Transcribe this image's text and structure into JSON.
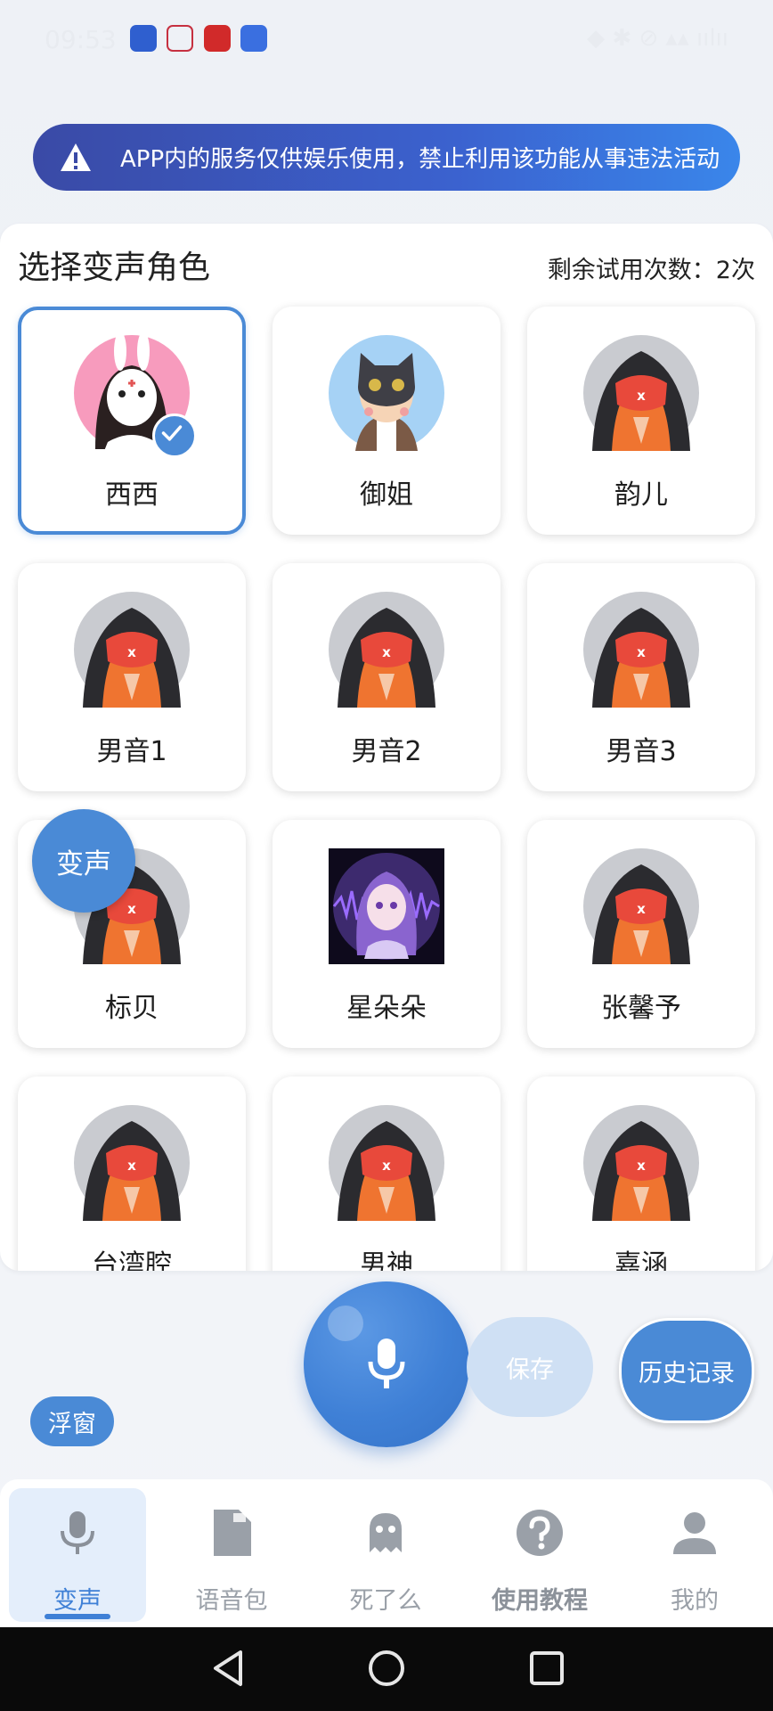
{
  "status_bar": {
    "time": "09:53",
    "right": "◆ ✱ ⊘  ▴▴ ıılıı"
  },
  "banner": {
    "text": "APP内的服务仅供娱乐使用，禁止利用该功能从事违法活动"
  },
  "panel": {
    "title": "选择变声角色",
    "trial_text": "剩余试用次数：2次",
    "characters": [
      {
        "name": "西西",
        "avatar": "bunny-mask-girl",
        "selected": true
      },
      {
        "name": "御姐",
        "avatar": "cat-mask-boy",
        "selected": false
      },
      {
        "name": "韵儿",
        "avatar": "hooded-figure",
        "selected": false
      },
      {
        "name": "男音1",
        "avatar": "hooded-figure",
        "selected": false
      },
      {
        "name": "男音2",
        "avatar": "hooded-figure",
        "selected": false
      },
      {
        "name": "男音3",
        "avatar": "hooded-figure",
        "selected": false
      },
      {
        "name": "标贝",
        "avatar": "hooded-figure",
        "selected": false
      },
      {
        "name": "星朵朵",
        "avatar": "anime-girl-purple",
        "selected": false
      },
      {
        "name": "张馨予",
        "avatar": "hooded-figure",
        "selected": false
      },
      {
        "name": "台湾腔",
        "avatar": "hooded-figure",
        "selected": false
      },
      {
        "name": "男神",
        "avatar": "hooded-figure",
        "selected": false
      },
      {
        "name": "嘉涵",
        "avatar": "hooded-figure",
        "selected": false
      }
    ]
  },
  "fab": {
    "voice_change": "变声"
  },
  "controls": {
    "save": "保存",
    "history": "历史记录",
    "float_window": "浮窗"
  },
  "nav": {
    "items": [
      {
        "label": "变声",
        "icon": "mic-icon",
        "active": true
      },
      {
        "label": "语音包",
        "icon": "document-icon",
        "active": false
      },
      {
        "label": "死了么",
        "icon": "ghost-icon",
        "active": false
      },
      {
        "label": "使用教程",
        "icon": "question-icon",
        "active": false
      },
      {
        "label": "我的",
        "icon": "person-icon",
        "active": false
      }
    ]
  },
  "colors": {
    "accent": "#4a8ad6",
    "banner_start": "#3a4aa6",
    "banner_end": "#3a86ea"
  }
}
